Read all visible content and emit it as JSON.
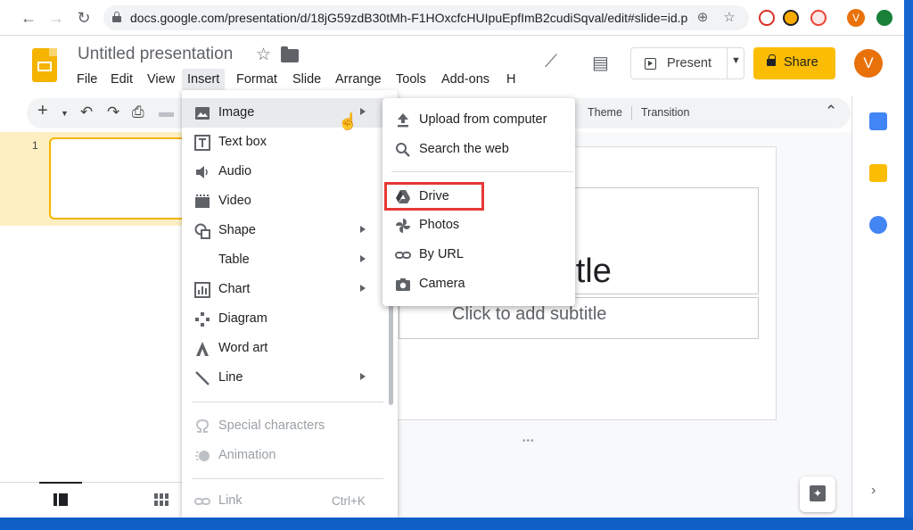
{
  "browser": {
    "url": "docs.google.com/presentation/d/18jG59zdB30tMh-F1HOxcfcHUIpuEpfImB2cudiSqval/edit#slide=id.p",
    "profile_initial": "V"
  },
  "app": {
    "doc_title": "Untitled presentation",
    "menus": [
      "File",
      "Edit",
      "View",
      "Insert",
      "Format",
      "Slide",
      "Arrange",
      "Tools",
      "Add-ons",
      "H"
    ],
    "active_menu": "Insert",
    "present_label": "Present",
    "share_label": "Share",
    "avatar_initial": "V"
  },
  "toolbar": {
    "theme_label": "Theme",
    "transition_label": "Transition"
  },
  "filmstrip": {
    "slide_number": "1"
  },
  "slide": {
    "title_visible": "d title",
    "subtitle_placeholder": "Click to add subtitle"
  },
  "insert_menu": {
    "image": "Image",
    "text_box": "Text box",
    "audio": "Audio",
    "video": "Video",
    "shape": "Shape",
    "table": "Table",
    "chart": "Chart",
    "diagram": "Diagram",
    "word_art": "Word art",
    "line": "Line",
    "special_characters": "Special characters",
    "animation": "Animation",
    "link": "Link",
    "link_shortcut": "Ctrl+K"
  },
  "image_submenu": {
    "upload": "Upload from computer",
    "search_web": "Search the web",
    "drive": "Drive",
    "photos": "Photos",
    "by_url": "By URL",
    "camera": "Camera"
  },
  "colors": {
    "accent_yellow": "#fbbc04",
    "highlight_red": "#e53935",
    "desktop_blue": "#1a73e8"
  }
}
